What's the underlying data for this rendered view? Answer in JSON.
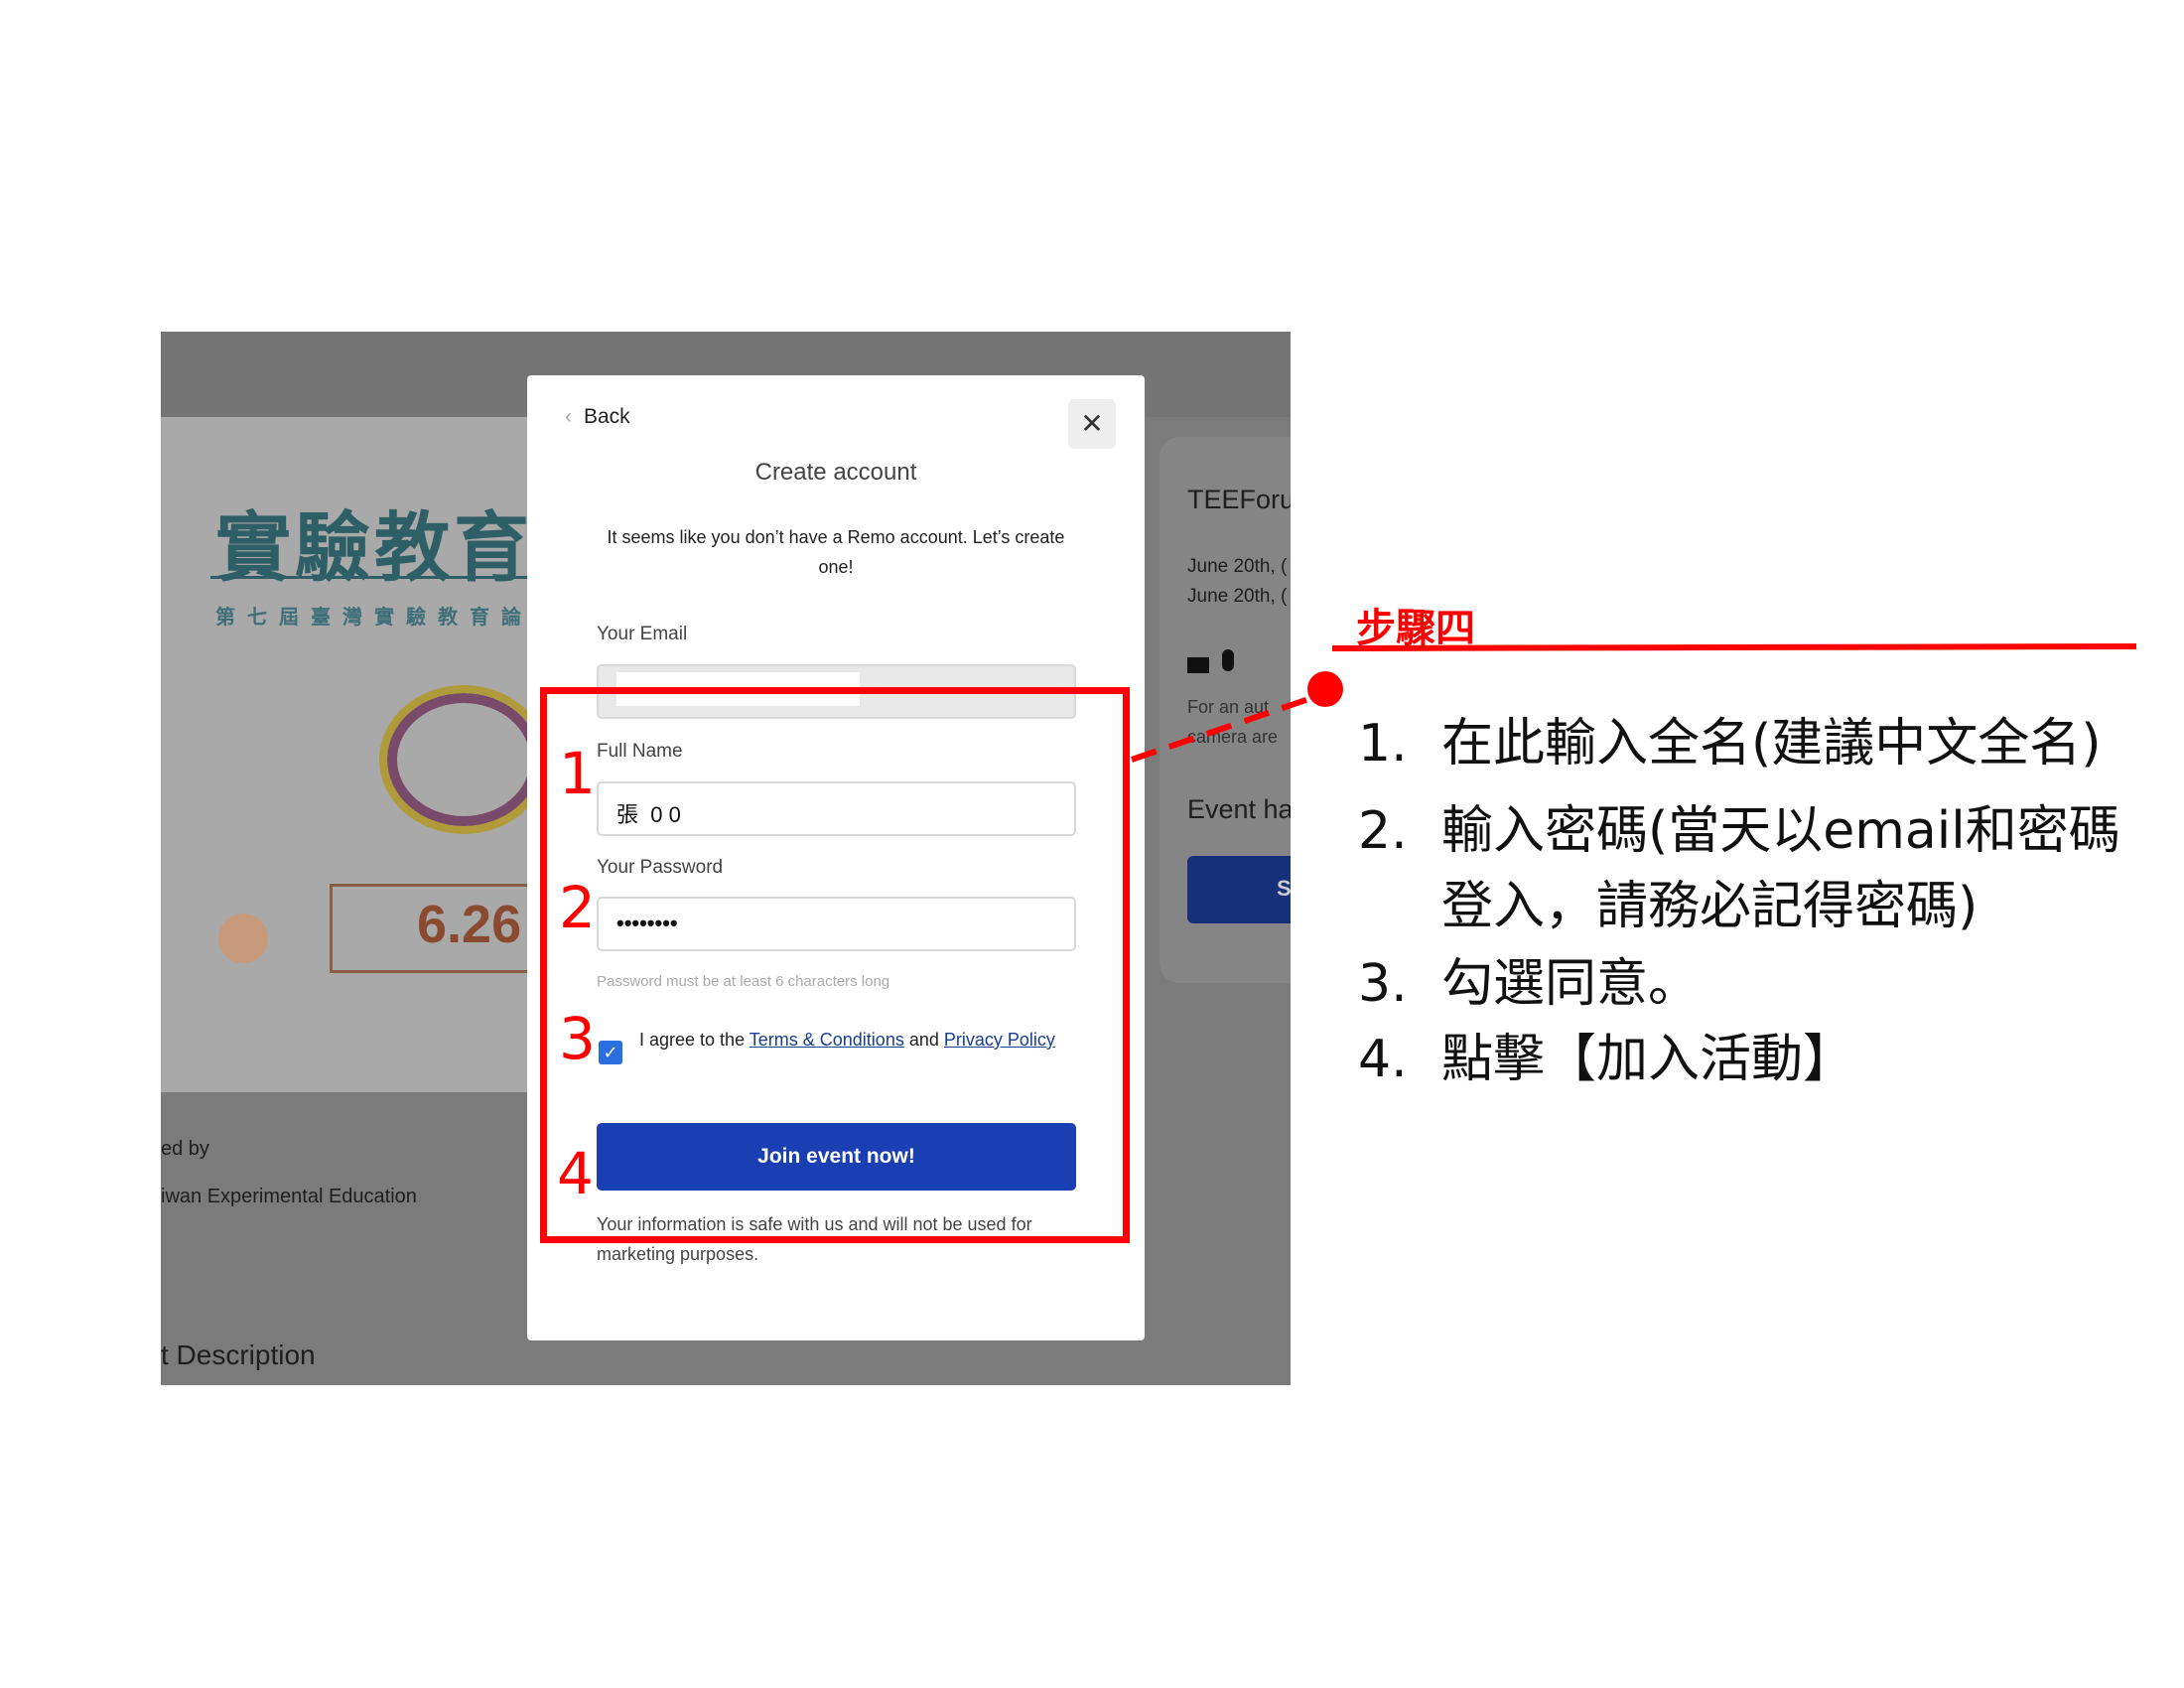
{
  "background_page": {
    "poster_title": "實驗教育",
    "poster_subtitle": "第七屆臺灣實驗教育論",
    "poster_date": "6.26",
    "hosted_by": "ed by",
    "organizer": "iwan Experimental Education",
    "description_heading": "t Description",
    "event_card": {
      "title": "TEEForu",
      "date_lines": [
        "June 20th, (",
        "June 20th, ("
      ],
      "icons": [
        "video-camera-icon",
        "microphone-icon"
      ],
      "note_lines": [
        "For an aut",
        "camera are"
      ],
      "event_heading": "Event ha",
      "button_label": "S",
      "button_color": "#1a3fa8"
    }
  },
  "modal": {
    "back_label": "Back",
    "title": "Create account",
    "subtitle": "It seems like you don’t have a Remo account. Let’s create one!",
    "email": {
      "label": "Your Email",
      "value": ""
    },
    "full_name": {
      "label": "Full Name",
      "value": "張  0 0"
    },
    "password": {
      "label": "Your Password",
      "value": "••••••••",
      "hint": "Password must be at least 6 characters long"
    },
    "agree": {
      "checked": true,
      "text_prefix": "I agree to the ",
      "terms_link": "Terms & Conditions",
      "and": " and ",
      "privacy_link": "Privacy Policy"
    },
    "submit_label": "Join event now!",
    "footer": "Your information is safe with us and will not be used for marketing purposes.",
    "accent_color": "#1a3fb3"
  },
  "annotations": {
    "step_numbers": [
      "1",
      "2",
      "3",
      "4"
    ],
    "step_title": "步驟四",
    "color": "#ff0000",
    "instructions": [
      {
        "n": "1.",
        "text": "在此輸入全名(建議中文全名)"
      },
      {
        "n": "2.",
        "text": "輸入密碼(當天以email和密碼",
        "text2": "登入，請務必記得密碼)"
      },
      {
        "n": "3.",
        "text": "勾選同意。"
      },
      {
        "n": "4.",
        "text": "點擊【加入活動】"
      }
    ]
  }
}
